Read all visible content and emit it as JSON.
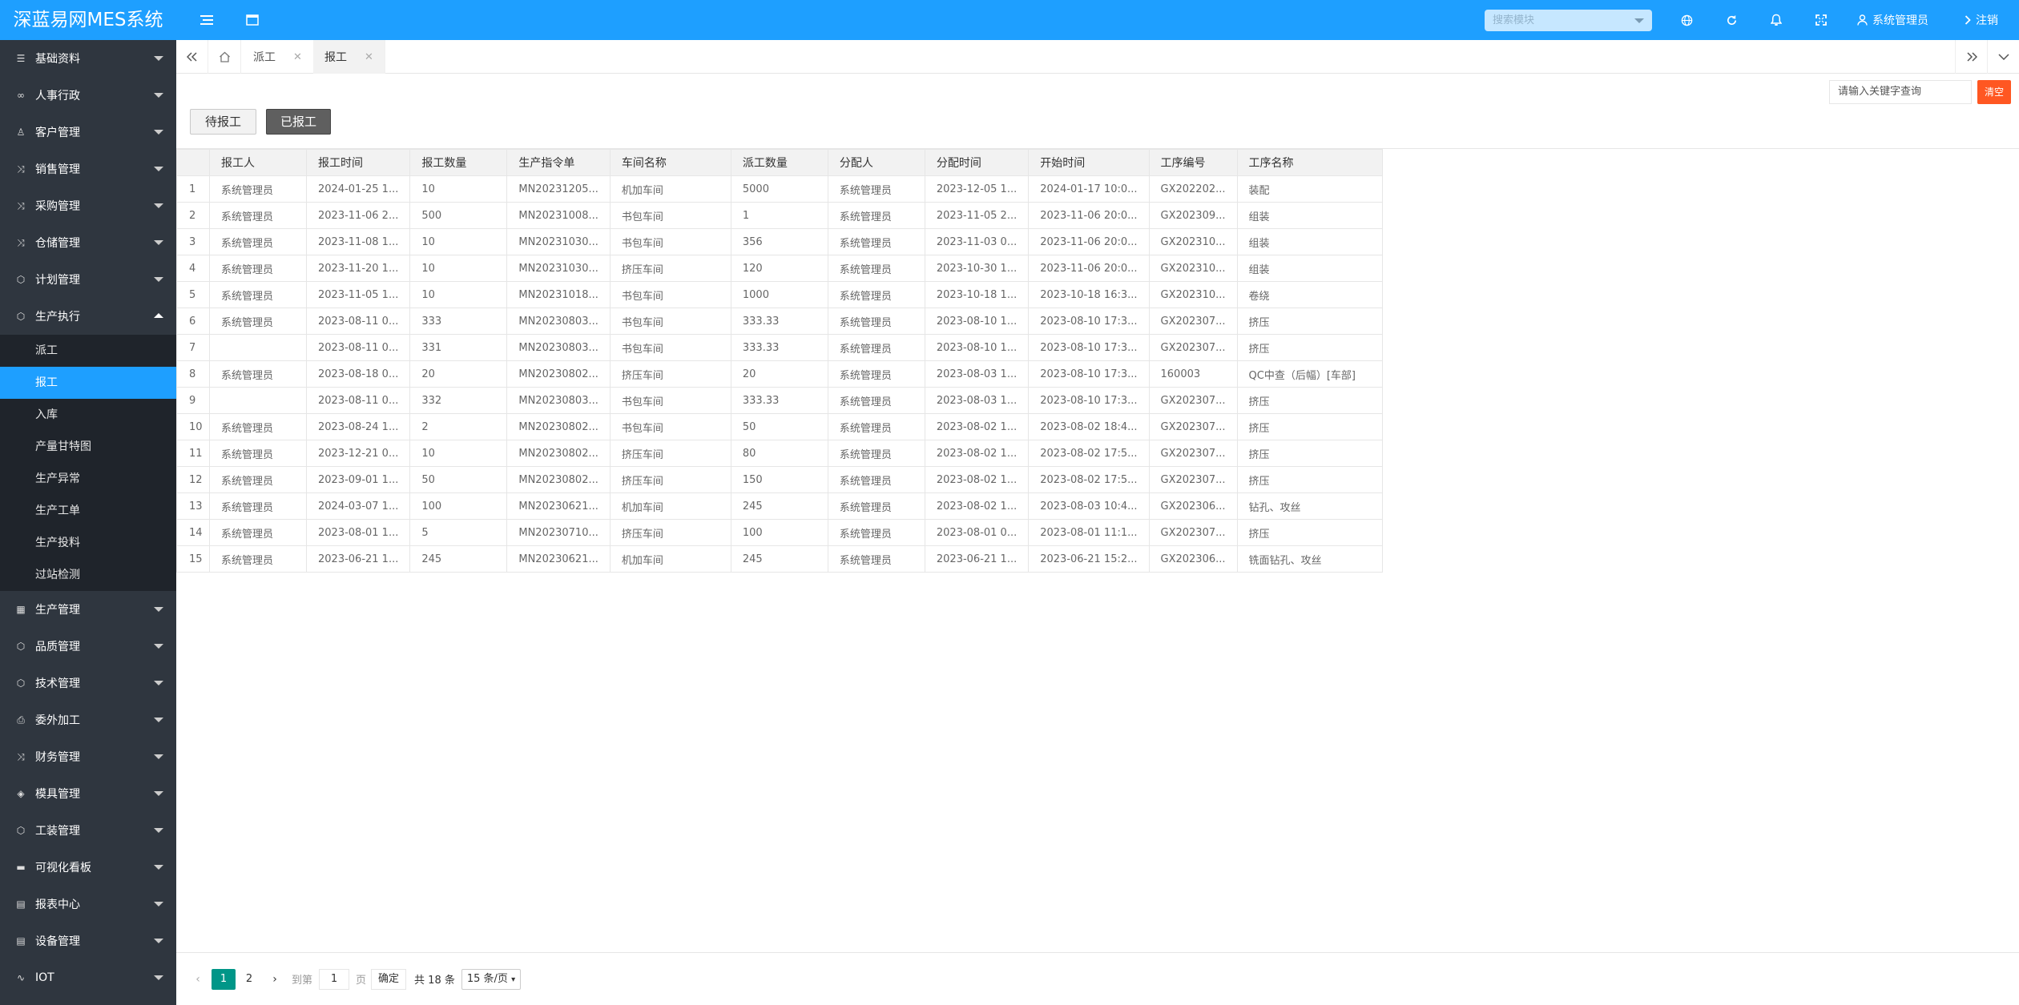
{
  "app": {
    "title": "深蓝易网MES系统"
  },
  "header": {
    "search_placeholder": "搜索模块",
    "user_name": "系统管理员",
    "logout_label": "注销"
  },
  "sidebar": {
    "items": [
      {
        "label": "基础资料",
        "icon": "list-icon"
      },
      {
        "label": "人事行政",
        "icon": "people-icon"
      },
      {
        "label": "客户管理",
        "icon": "user-icon"
      },
      {
        "label": "销售管理",
        "icon": "shuffle-icon"
      },
      {
        "label": "采购管理",
        "icon": "shuffle-icon"
      },
      {
        "label": "仓储管理",
        "icon": "shuffle-icon"
      },
      {
        "label": "计划管理",
        "icon": "cube-icon"
      },
      {
        "label": "生产执行",
        "icon": "cube-icon"
      }
    ],
    "subitems": [
      {
        "label": "派工"
      },
      {
        "label": "报工"
      },
      {
        "label": "入库"
      },
      {
        "label": "产量甘特图"
      },
      {
        "label": "生产异常"
      },
      {
        "label": "生产工单"
      },
      {
        "label": "生产投料"
      },
      {
        "label": "过站检测"
      }
    ],
    "items2": [
      {
        "label": "生产管理",
        "icon": "calendar-icon"
      },
      {
        "label": "品质管理",
        "icon": "cube-icon"
      },
      {
        "label": "技术管理",
        "icon": "cube-icon"
      },
      {
        "label": "委外加工",
        "icon": "print-icon"
      },
      {
        "label": "财务管理",
        "icon": "shuffle-icon"
      },
      {
        "label": "模具管理",
        "icon": "cubes-icon"
      },
      {
        "label": "工装管理",
        "icon": "cube-icon"
      },
      {
        "label": "可视化看板",
        "icon": "chat-icon"
      },
      {
        "label": "报表中心",
        "icon": "table-icon"
      },
      {
        "label": "设备管理",
        "icon": "table-icon"
      },
      {
        "label": "IOT",
        "icon": "pulse-icon"
      }
    ]
  },
  "tabs": [
    {
      "label": "派工"
    },
    {
      "label": "报工"
    }
  ],
  "toolbar": {
    "keyword_placeholder": "请输入关键字查询",
    "clear_label": "清空",
    "pending_label": "待报工",
    "done_label": "已报工"
  },
  "table": {
    "columns": [
      "",
      "报工人",
      "报工时间",
      "报工数量",
      "生产指令单",
      "车间名称",
      "派工数量",
      "分配人",
      "分配时间",
      "开始时间",
      "工序编号",
      "工序名称"
    ],
    "rows": [
      [
        "1",
        "系统管理员",
        "2024-01-25 1...",
        "10",
        "MN20231205...",
        "机加车间",
        "5000",
        "系统管理员",
        "2023-12-05 1...",
        "2024-01-17 10:0...",
        "GX202202...",
        "装配"
      ],
      [
        "2",
        "系统管理员",
        "2023-11-06 2...",
        "500",
        "MN20231008...",
        "书包车间",
        "1",
        "系统管理员",
        "2023-11-05 2...",
        "2023-11-06 20:0...",
        "GX202309...",
        "组装"
      ],
      [
        "3",
        "系统管理员",
        "2023-11-08 1...",
        "10",
        "MN20231030...",
        "书包车间",
        "356",
        "系统管理员",
        "2023-11-03 0...",
        "2023-11-06 20:0...",
        "GX202310...",
        "组装"
      ],
      [
        "4",
        "系统管理员",
        "2023-11-20 1...",
        "10",
        "MN20231030...",
        "挤压车间",
        "120",
        "系统管理员",
        "2023-10-30 1...",
        "2023-11-06 20:0...",
        "GX202310...",
        "组装"
      ],
      [
        "5",
        "系统管理员",
        "2023-11-05 1...",
        "10",
        "MN20231018...",
        "书包车间",
        "1000",
        "系统管理员",
        "2023-10-18 1...",
        "2023-10-18 16:3...",
        "GX202310...",
        "卷绕"
      ],
      [
        "6",
        "系统管理员",
        "2023-08-11 0...",
        "333",
        "MN20230803...",
        "书包车间",
        "333.33",
        "系统管理员",
        "2023-08-10 1...",
        "2023-08-10 17:3...",
        "GX202307...",
        "挤压"
      ],
      [
        "7",
        "",
        "2023-08-11 0...",
        "331",
        "MN20230803...",
        "书包车间",
        "333.33",
        "系统管理员",
        "2023-08-10 1...",
        "2023-08-10 17:3...",
        "GX202307...",
        "挤压"
      ],
      [
        "8",
        "系统管理员",
        "2023-08-18 0...",
        "20",
        "MN20230802...",
        "挤压车间",
        "20",
        "系统管理员",
        "2023-08-03 1...",
        "2023-08-10 17:3...",
        "160003",
        "QC中查（后幅）[车部]"
      ],
      [
        "9",
        "",
        "2023-08-11 0...",
        "332",
        "MN20230803...",
        "书包车间",
        "333.33",
        "系统管理员",
        "2023-08-03 1...",
        "2023-08-10 17:3...",
        "GX202307...",
        "挤压"
      ],
      [
        "10",
        "系统管理员",
        "2023-08-24 1...",
        "2",
        "MN20230802...",
        "书包车间",
        "50",
        "系统管理员",
        "2023-08-02 1...",
        "2023-08-02 18:4...",
        "GX202307...",
        "挤压"
      ],
      [
        "11",
        "系统管理员",
        "2023-12-21 0...",
        "10",
        "MN20230802...",
        "挤压车间",
        "80",
        "系统管理员",
        "2023-08-02 1...",
        "2023-08-02 17:5...",
        "GX202307...",
        "挤压"
      ],
      [
        "12",
        "系统管理员",
        "2023-09-01 1...",
        "50",
        "MN20230802...",
        "挤压车间",
        "150",
        "系统管理员",
        "2023-08-02 1...",
        "2023-08-02 17:5...",
        "GX202307...",
        "挤压"
      ],
      [
        "13",
        "系统管理员",
        "2024-03-07 1...",
        "100",
        "MN20230621...",
        "机加车间",
        "245",
        "系统管理员",
        "2023-08-02 1...",
        "2023-08-03 10:4...",
        "GX202306...",
        "钻孔、攻丝"
      ],
      [
        "14",
        "系统管理员",
        "2023-08-01 1...",
        "5",
        "MN20230710...",
        "挤压车间",
        "100",
        "系统管理员",
        "2023-08-01 0...",
        "2023-08-01 11:1...",
        "GX202307...",
        "挤压"
      ],
      [
        "15",
        "系统管理员",
        "2023-06-21 1...",
        "245",
        "MN20230621...",
        "机加车间",
        "245",
        "系统管理员",
        "2023-06-21 1...",
        "2023-06-21 15:2...",
        "GX202306...",
        "铣面钻孔、攻丝"
      ]
    ]
  },
  "pager": {
    "pages": [
      "1",
      "2"
    ],
    "current": "1",
    "goto_label": "到第",
    "goto_value": "1",
    "page_unit": "页",
    "confirm_label": "确定",
    "total_label": "共 18 条",
    "page_size": "15 条/页"
  }
}
